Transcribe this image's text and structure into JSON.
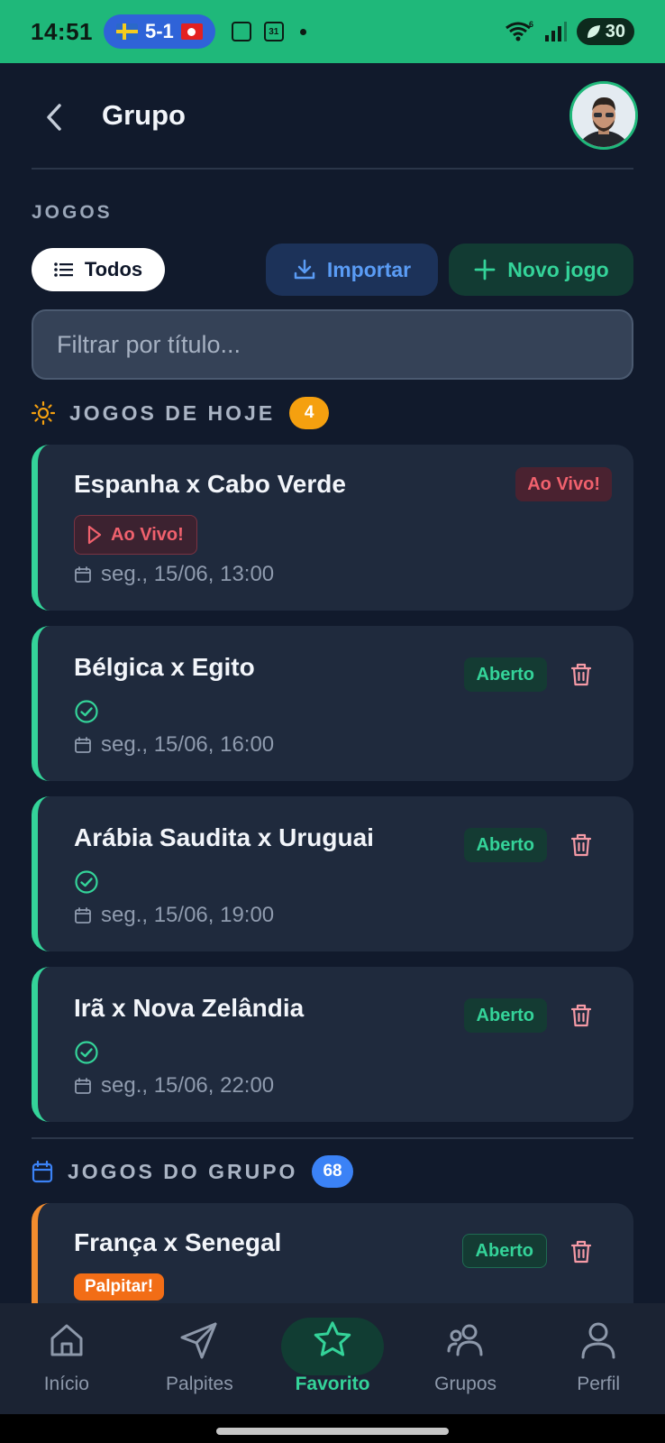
{
  "status_bar": {
    "time": "14:51",
    "score": "5-1",
    "calendar_day": "31",
    "wifi_badge": "6",
    "battery": "30"
  },
  "header": {
    "title": "Grupo"
  },
  "section_title": "JOGOS",
  "toolbar": {
    "todos_label": "Todos",
    "import_label": "Importar",
    "new_game_label": "Novo jogo"
  },
  "filter": {
    "placeholder": "Filtrar por título..."
  },
  "today": {
    "label": "JOGOS DE HOJE",
    "count": "4",
    "games": [
      {
        "title": "Espanha x Cabo Verde",
        "status": "Ao Vivo!",
        "live_chip": "Ao Vivo!",
        "date": "seg., 15/06, 13:00"
      },
      {
        "title": "Bélgica x Egito",
        "status": "Aberto",
        "date": "seg., 15/06, 16:00"
      },
      {
        "title": "Arábia Saudita x Uruguai",
        "status": "Aberto",
        "date": "seg., 15/06, 19:00"
      },
      {
        "title": "Irã x Nova Zelândia",
        "status": "Aberto",
        "date": "seg., 15/06, 22:00"
      }
    ]
  },
  "group_games": {
    "label": "JOGOS DO GRUPO",
    "count": "68",
    "games": [
      {
        "title": "França x Senegal",
        "status": "Aberto",
        "tag": "Palpitar!"
      }
    ]
  },
  "nav": [
    {
      "label": "Início",
      "icon": "home-icon"
    },
    {
      "label": "Palpites",
      "icon": "send-icon"
    },
    {
      "label": "Favorito",
      "icon": "star-icon",
      "active": true
    },
    {
      "label": "Grupos",
      "icon": "users-icon"
    },
    {
      "label": "Perfil",
      "icon": "user-icon"
    }
  ],
  "colors": {
    "accent_green": "#34d399",
    "status_bar": "#1fb87a",
    "background": "#111a2c",
    "card": "#1f2a3d",
    "live_red": "#f0616d",
    "today_badge": "#f5a00f",
    "group_badge": "#3b82f6",
    "palpitar_orange": "#f26d16"
  }
}
